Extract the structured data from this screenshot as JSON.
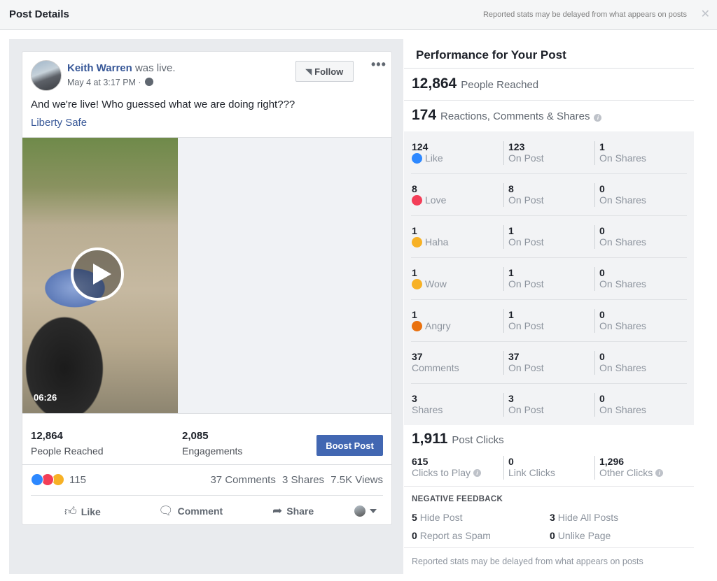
{
  "header": {
    "title": "Post Details",
    "note": "Reported stats may be delayed from what appears on posts",
    "close_glyph": "✕"
  },
  "post": {
    "author": "Keith Warren",
    "author_suffix": "was live.",
    "date": "May 4 at 3:17 PM ·",
    "follow_label": "Follow",
    "more_glyph": "•••",
    "text": "And we're live! Who guessed what we are doing right???",
    "link": "Liberty Safe",
    "video_duration": "06:26",
    "people_reached_num": "12,864",
    "people_reached_label": "People Reached",
    "engagements_num": "2,085",
    "engagements_label": "Engagements",
    "boost_label": "Boost Post",
    "reaction_count": "115",
    "comments": "37 Comments",
    "shares": "3 Shares",
    "views": "7.5K Views",
    "actions": {
      "like": "Like",
      "comment": "Comment",
      "share": "Share"
    }
  },
  "performance": {
    "title": "Performance for Your Post",
    "reached_num": "12,864",
    "reached_label": "People Reached",
    "rcs_num": "174",
    "rcs_label": "Reactions, Comments & Shares",
    "rows": [
      {
        "num": "124",
        "label": "Like",
        "emoji": "like-icon",
        "color": "#2d88ff",
        "post_num": "123",
        "post_label": "On Post",
        "share_num": "1",
        "share_label": "On Shares"
      },
      {
        "num": "8",
        "label": "Love",
        "emoji": "love-icon",
        "color": "#f33e58",
        "post_num": "8",
        "post_label": "On Post",
        "share_num": "0",
        "share_label": "On Shares"
      },
      {
        "num": "1",
        "label": "Haha",
        "emoji": "haha-icon",
        "color": "#f7b125",
        "post_num": "1",
        "post_label": "On Post",
        "share_num": "0",
        "share_label": "On Shares"
      },
      {
        "num": "1",
        "label": "Wow",
        "emoji": "wow-icon",
        "color": "#f7b125",
        "post_num": "1",
        "post_label": "On Post",
        "share_num": "0",
        "share_label": "On Shares"
      },
      {
        "num": "1",
        "label": "Angry",
        "emoji": "angry-icon",
        "color": "#e9710f",
        "post_num": "1",
        "post_label": "On Post",
        "share_num": "0",
        "share_label": "On Shares"
      },
      {
        "num": "37",
        "label": "Comments",
        "emoji": "",
        "color": "",
        "post_num": "37",
        "post_label": "On Post",
        "share_num": "0",
        "share_label": "On Shares"
      },
      {
        "num": "3",
        "label": "Shares",
        "emoji": "",
        "color": "",
        "post_num": "3",
        "post_label": "On Post",
        "share_num": "0",
        "share_label": "On Shares"
      }
    ],
    "clicks_num": "1,911",
    "clicks_label": "Post Clicks",
    "play_num": "615",
    "play_label": "Clicks to Play",
    "link_num": "0",
    "link_label": "Link Clicks",
    "other_num": "1,296",
    "other_label": "Other Clicks",
    "negative_title": "NEGATIVE FEEDBACK",
    "hide_post_num": "5",
    "hide_post_label": "Hide Post",
    "hide_all_num": "3",
    "hide_all_label": "Hide All Posts",
    "spam_num": "0",
    "spam_label": "Report as Spam",
    "unlike_num": "0",
    "unlike_label": "Unlike Page",
    "footer_note": "Reported stats may be delayed from what appears on posts"
  }
}
